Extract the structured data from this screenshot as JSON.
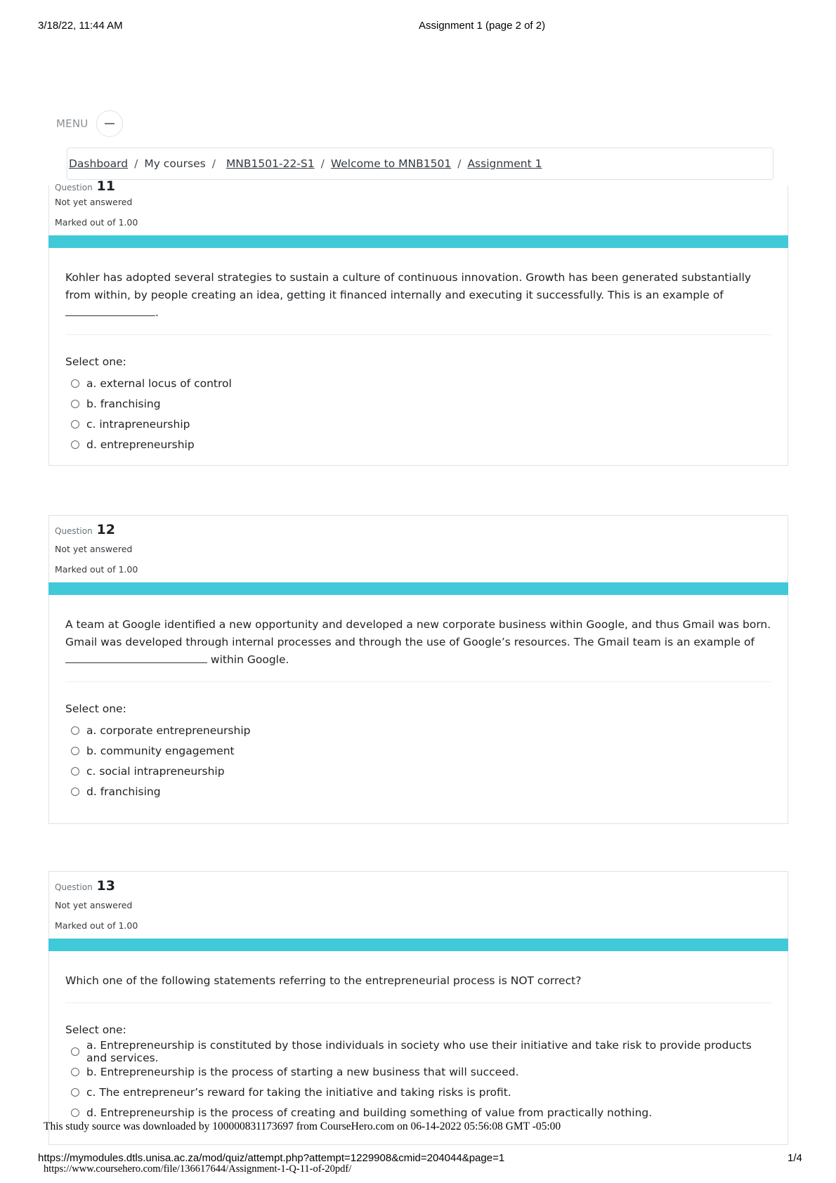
{
  "print_header": {
    "datetime": "3/18/22, 11:44 AM",
    "title": "Assignment 1 (page 2 of 2)"
  },
  "menu": {
    "label": "MENU",
    "icon": "hamburger-icon"
  },
  "breadcrumb": {
    "items": [
      {
        "label": "Dashboard",
        "link": true
      },
      {
        "label": "My courses",
        "link": false
      },
      {
        "label": "MNB1501-22-S1",
        "link": true
      },
      {
        "label": "Welcome to MNB1501",
        "link": true
      },
      {
        "label": "Assignment 1",
        "link": true
      }
    ],
    "separator": "/"
  },
  "questions": [
    {
      "label": "Question",
      "number": "11",
      "state": "Not yet answered",
      "marks": "Marked out of 1.00",
      "text": "Kohler has adopted several strategies to sustain a culture of continuous innovation. Growth has been generated substantially from within, by people creating an idea, getting it financed internally and executing it successfully. This is an example of ",
      "text_after_blank": ".",
      "select_label": "Select one:",
      "answers": [
        "a. external locus of control",
        "b. franchising",
        "c. intrapreneurship",
        "d. entrepreneurship"
      ]
    },
    {
      "label": "Question",
      "number": "12",
      "state": "Not yet answered",
      "marks": "Marked out of 1.00",
      "text": "A team at Google identified a new opportunity and developed a new corporate business within Google, and thus Gmail was born. Gmail was developed through internal processes and through the use of Google’s resources. The Gmail team is an example of",
      "text_after_blank": " within Google.",
      "select_label": "Select one:",
      "answers": [
        "a. corporate entrepreneurship",
        "b. community engagement",
        "c. social intrapreneurship",
        "d. franchising"
      ]
    },
    {
      "label": "Question",
      "number": "13",
      "state": "Not yet answered",
      "marks": "Marked out of 1.00",
      "text": "Which one of the following statements referring to the entrepreneurial process is NOT correct?",
      "select_label": "Select one:",
      "answers": [
        "a. Entrepreneurship is constituted by those individuals in society who use their initiative and take risk to provide products and services.",
        "b. Entrepreneurship is the process of starting a new business that will succeed.",
        "c. The entrepreneur’s reward for taking the initiative and taking risks is profit.",
        "d. Entrepreneurship is the process of creating and building something of value from practically nothing."
      ]
    }
  ],
  "footer": {
    "watermark_download": "This study source was downloaded by 100000831173697 from CourseHero.com on 06-14-2022 05:56:08 GMT -05:00",
    "page_url": "https://mymodules.dtls.unisa.ac.za/mod/quiz/attempt.php?attempt=1229908&cmid=204044&page=1",
    "page_number": "1/4",
    "watermark_url": "https://www.coursehero.com/file/136617644/Assignment-1-Q-11-of-20pdf/"
  },
  "colors": {
    "accent_bar": "#40c9d9",
    "border": "#dee2e6"
  }
}
